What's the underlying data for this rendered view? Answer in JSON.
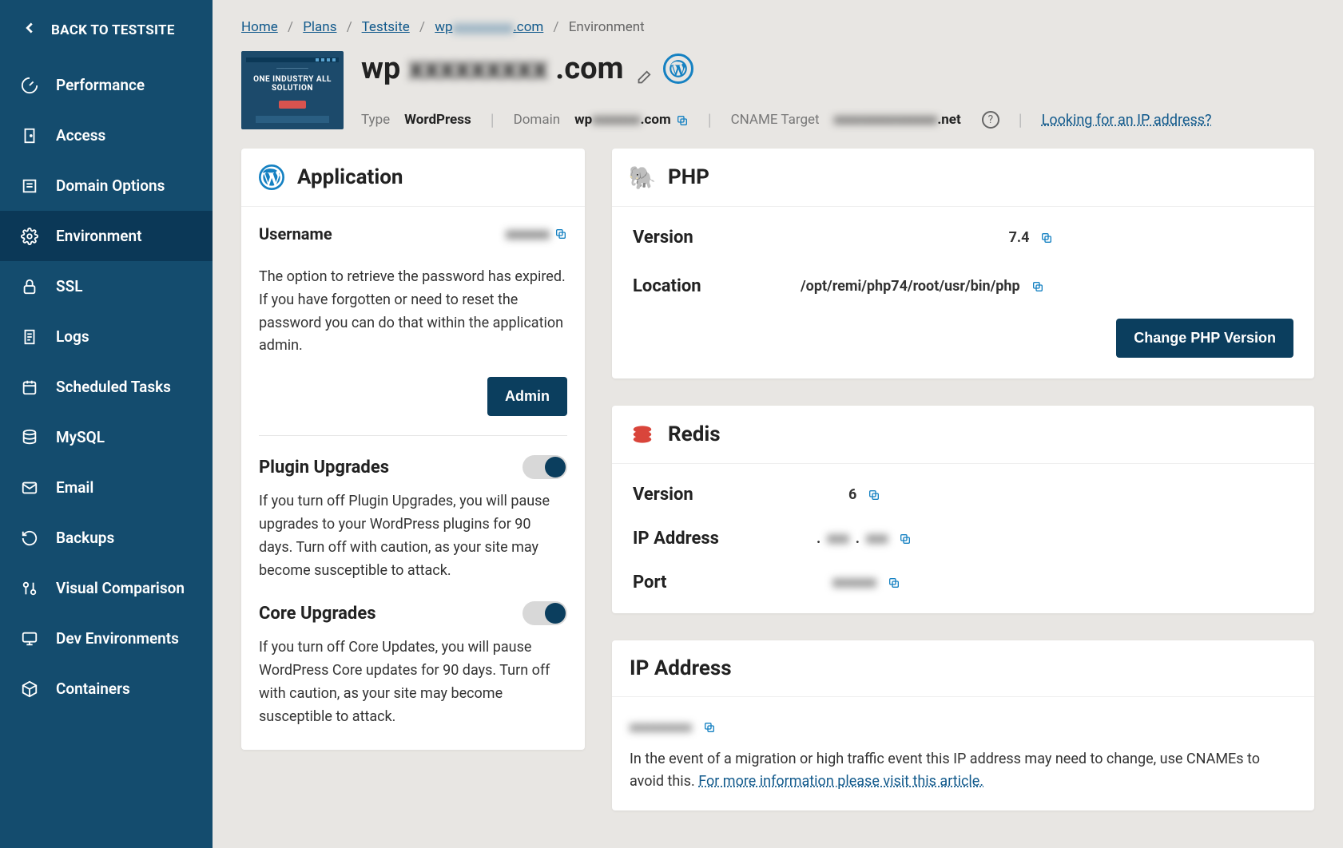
{
  "sidebar": {
    "back_label": "BACK TO TESTSITE",
    "items": [
      {
        "label": "Performance"
      },
      {
        "label": "Access"
      },
      {
        "label": "Domain Options"
      },
      {
        "label": "Environment",
        "active": true
      },
      {
        "label": "SSL"
      },
      {
        "label": "Logs"
      },
      {
        "label": "Scheduled Tasks"
      },
      {
        "label": "MySQL"
      },
      {
        "label": "Email"
      },
      {
        "label": "Backups"
      },
      {
        "label": "Visual Comparison"
      },
      {
        "label": "Dev Environments"
      },
      {
        "label": "Containers"
      }
    ]
  },
  "breadcrumb": {
    "home": "Home",
    "plans": "Plans",
    "testsite": "Testsite",
    "domain_prefix": "wp",
    "domain_blur": "xxxxxxxxx",
    "domain_suffix": ".com",
    "current": "Environment"
  },
  "header": {
    "thumb_text": "ONE INDUSTRY ALL SOLUTION",
    "title_prefix": "wp",
    "title_blur": "xxxxxxxxx",
    "title_suffix": ".com"
  },
  "meta": {
    "type_label": "Type",
    "type_value": "WordPress",
    "domain_label": "Domain",
    "domain_prefix": "wp",
    "domain_blur": "xxxxxxx",
    "domain_suffix": ".com",
    "cname_label": "CNAME Target",
    "cname_blur": "xxxxxxxxxxxxxxx",
    "cname_suffix": ".net",
    "ip_link": "Looking for an IP address?"
  },
  "app_card": {
    "title": "Application",
    "username_label": "Username",
    "username_value_blur": "xxxxxx",
    "password_text": "The option to retrieve the password has expired. If you have forgotten or need to reset the password you can do that within the application admin.",
    "admin_btn": "Admin",
    "plugin_title": "Plugin Upgrades",
    "plugin_text": "If you turn off Plugin Upgrades, you will pause upgrades to your WordPress plugins for 90 days. Turn off with caution, as your site may become susceptible to attack.",
    "core_title": "Core Upgrades",
    "core_text": "If you turn off Core Updates, you will pause WordPress Core updates for 90 days. Turn off with caution, as your site may become susceptible to attack."
  },
  "php_card": {
    "title": "PHP",
    "version_label": "Version",
    "version_value": "7.4",
    "location_label": "Location",
    "location_value": "/opt/remi/php74/root/usr/bin/php",
    "change_btn": "Change PHP Version"
  },
  "redis_card": {
    "title": "Redis",
    "version_label": "Version",
    "version_value": "6",
    "ip_label": "IP Address",
    "ip_blur1": "xxx",
    "ip_blur2": "xxx",
    "port_label": "Port",
    "port_blur": "xxxxxx"
  },
  "ip_card": {
    "title": "IP Address",
    "value_blur": "xxxxxxxxx",
    "text_before": "In the event of a migration or high traffic event this IP address may need to change, use CNAMEs to avoid this. ",
    "link": "For more information please visit this article."
  }
}
